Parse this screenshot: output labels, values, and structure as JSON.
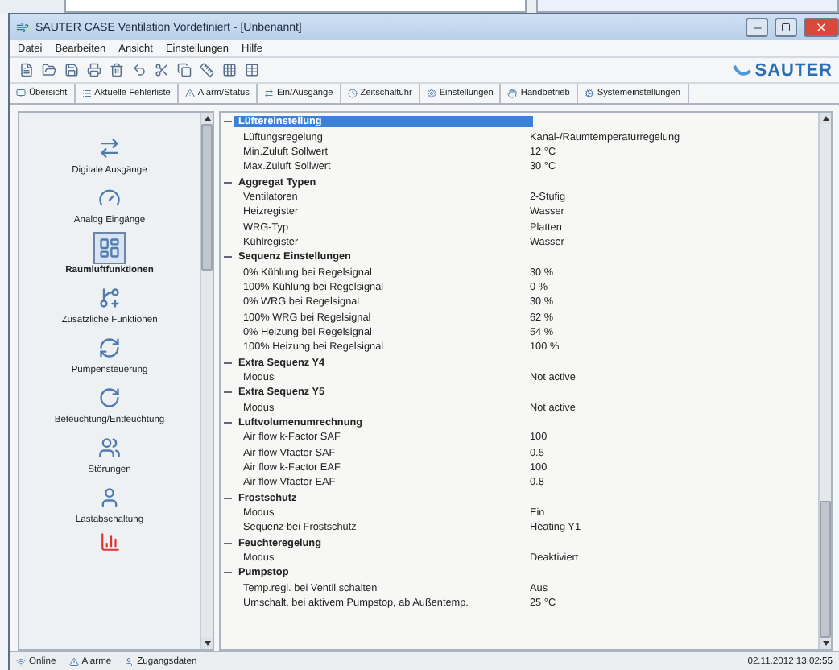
{
  "window": {
    "title": "SAUTER CASE Ventilation Vordefiniert - [Unbenannt]"
  },
  "menu": [
    "Datei",
    "Bearbeiten",
    "Ansicht",
    "Einstellungen",
    "Hilfe"
  ],
  "brand": "SAUTER",
  "tabs": [
    {
      "label": "Übersicht",
      "selected": false
    },
    {
      "label": "Aktuelle Fehlerliste",
      "selected": false
    },
    {
      "label": "Alarm/Status",
      "selected": false
    },
    {
      "label": "Ein/Ausgänge",
      "selected": false
    },
    {
      "label": "Zeitschaltuhr",
      "selected": false
    },
    {
      "label": "Einstellungen",
      "selected": false
    },
    {
      "label": "Handbetrieb",
      "selected": false
    },
    {
      "label": "Systemeinstellungen",
      "selected": false
    }
  ],
  "sidebar": {
    "items": [
      {
        "label": "Digitale Ausgänge",
        "selected": false
      },
      {
        "label": "Analog Eingänge",
        "selected": false
      },
      {
        "label": "Raumluftfunktionen",
        "selected": true
      },
      {
        "label": "Zusätzliche Funktionen",
        "selected": false
      },
      {
        "label": "Pumpensteuerung",
        "selected": false
      },
      {
        "label": "Befeuchtung/Entfeuchtung",
        "selected": false
      },
      {
        "label": "Störungen",
        "selected": false
      },
      {
        "label": "Lastabschaltung",
        "selected": false
      }
    ]
  },
  "tree": [
    {
      "label": "Lüftereinstellung",
      "expanded": true,
      "selected": true,
      "children": [
        {
          "label": "Lüftungsregelung",
          "value": "Kanal-/Raumtemperaturregelung"
        },
        {
          "label": "Min.Zuluft Sollwert",
          "value": "12 °C"
        },
        {
          "label": "Max.Zuluft Sollwert",
          "value": "30 °C"
        }
      ]
    },
    {
      "label": "Aggregat Typen",
      "expanded": true,
      "selected": false,
      "children": [
        {
          "label": "Ventilatoren",
          "value": "2-Stufig"
        },
        {
          "label": "Heizregister",
          "value": "Wasser"
        },
        {
          "label": "WRG-Typ",
          "value": "Platten"
        },
        {
          "label": "Kühlregister",
          "value": "Wasser"
        }
      ]
    },
    {
      "label": "Sequenz Einstellungen",
      "expanded": true,
      "selected": false,
      "children": [
        {
          "label": "0% Kühlung bei Regelsignal",
          "value": "30 %"
        },
        {
          "label": "100% Kühlung bei Regelsignal",
          "value": "0 %"
        },
        {
          "label": "0% WRG bei Regelsignal",
          "value": "30 %"
        },
        {
          "label": "100% WRG bei Regelsignal",
          "value": "62 %"
        },
        {
          "label": "0% Heizung bei Regelsignal",
          "value": "54 %"
        },
        {
          "label": "100% Heizung bei Regelsignal",
          "value": "100 %"
        }
      ]
    },
    {
      "label": "Extra Sequenz Y4",
      "expanded": true,
      "selected": false,
      "children": [
        {
          "label": "Modus",
          "value": "Not active"
        }
      ]
    },
    {
      "label": "Extra Sequenz Y5",
      "expanded": true,
      "selected": false,
      "children": [
        {
          "label": "Modus",
          "value": "Not active"
        }
      ]
    },
    {
      "label": "Luftvolumenumrechnung",
      "expanded": true,
      "selected": false,
      "children": [
        {
          "label": "Air flow k-Factor SAF",
          "value": "100"
        },
        {
          "label": "Air flow Vfactor SAF",
          "value": "0.5"
        },
        {
          "label": "Air flow k-Factor EAF",
          "value": "100"
        },
        {
          "label": "Air flow Vfactor EAF",
          "value": "0.8"
        }
      ]
    },
    {
      "label": "Frostschutz",
      "expanded": true,
      "selected": false,
      "children": [
        {
          "label": "Modus",
          "value": "Ein"
        },
        {
          "label": "Sequenz bei Frostschutz",
          "value": "Heating Y1"
        }
      ]
    },
    {
      "label": "Feuchteregelung",
      "expanded": true,
      "selected": false,
      "children": [
        {
          "label": "Modus",
          "value": "Deaktiviert"
        }
      ]
    },
    {
      "label": "Pumpstop",
      "expanded": true,
      "selected": false,
      "children": [
        {
          "label": "Temp.regl. bei Ventil schalten",
          "value": "Aus"
        },
        {
          "label": "Umschalt. bei aktivem Pumpstop, ab Außentemp.",
          "value": "25 °C"
        }
      ]
    }
  ],
  "status_bar": {
    "items": [
      "Online",
      "Alarme",
      "Zugangsdaten"
    ],
    "datetime": "02.11.2012 13:02:55"
  }
}
